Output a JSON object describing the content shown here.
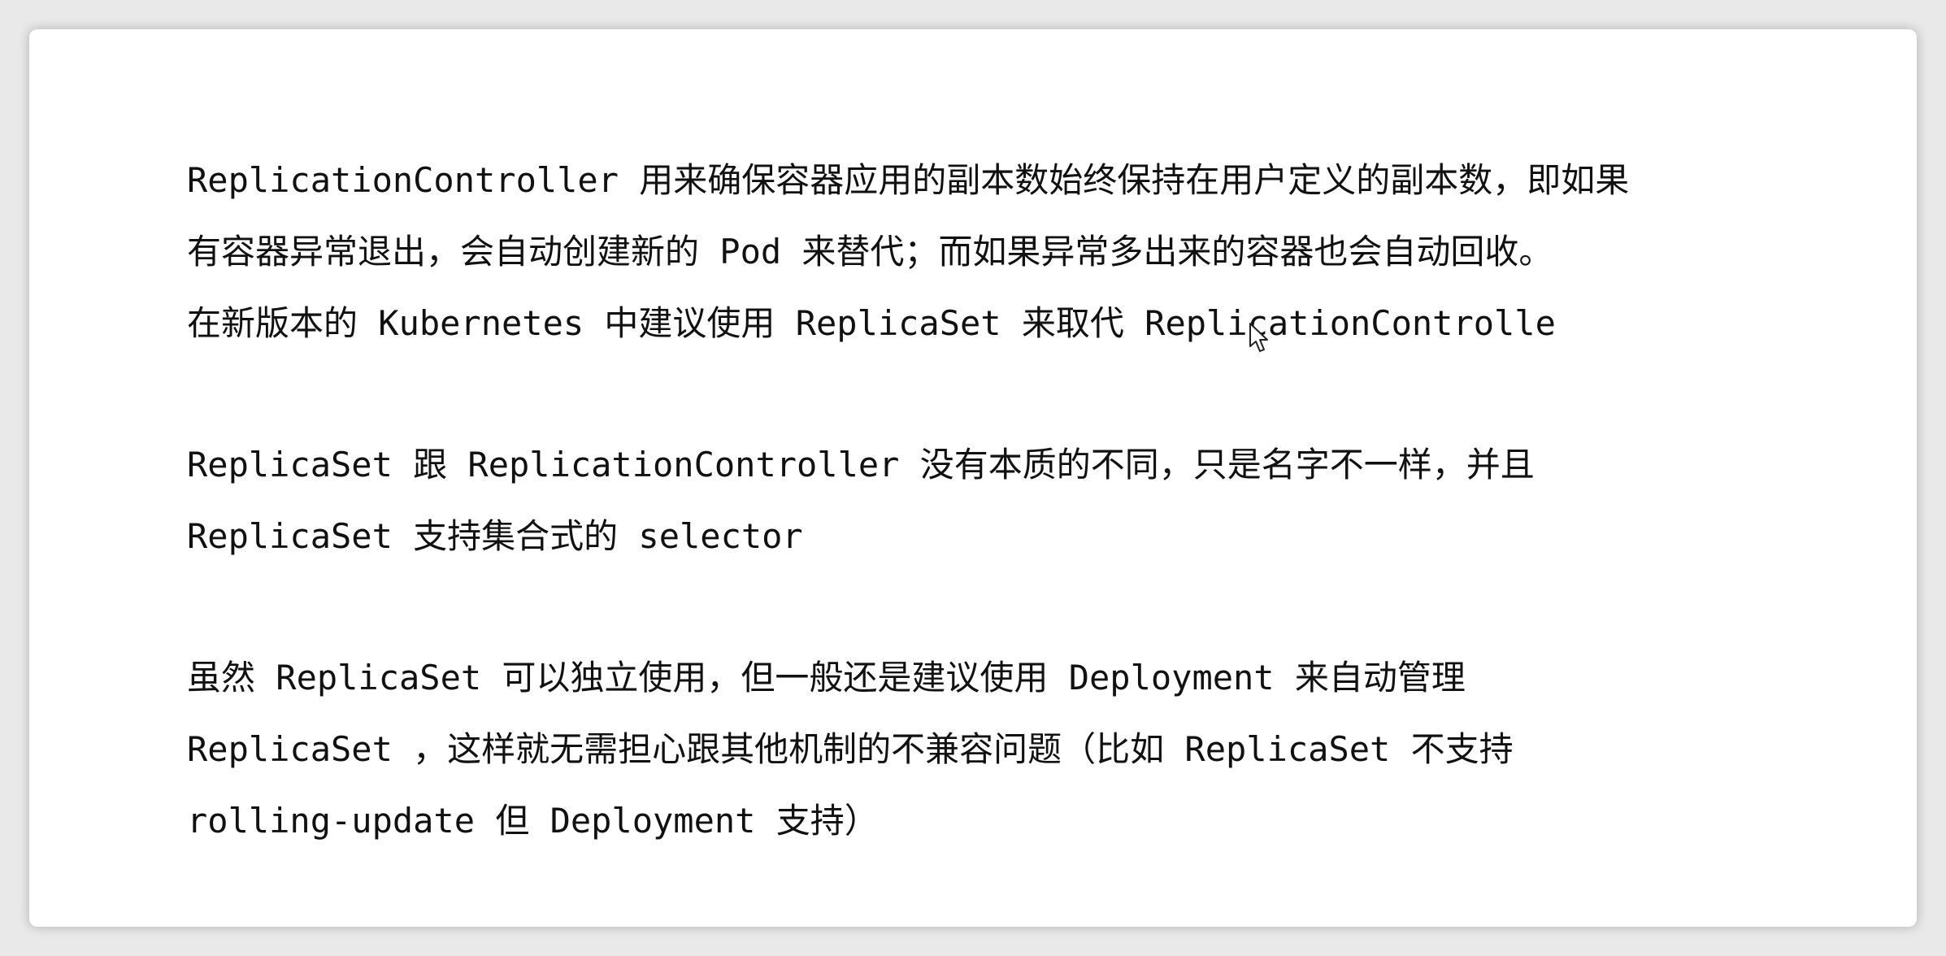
{
  "paragraphs": [
    {
      "lines": [
        "ReplicationController 用来确保容器应用的副本数始终保持在用户定义的副本数，即如果",
        "有容器异常退出，会自动创建新的 Pod 来替代；而如果异常多出来的容器也会自动回收。",
        "在新版本的 Kubernetes 中建议使用 ReplicaSet 来取代 ReplicationControlle"
      ]
    },
    {
      "lines": [
        "ReplicaSet 跟 ReplicationController 没有本质的不同，只是名字不一样，并且",
        "ReplicaSet 支持集合式的 selector"
      ]
    },
    {
      "lines": [
        "虽然 ReplicaSet 可以独立使用，但一般还是建议使用 Deployment 来自动管理",
        "ReplicaSet ，这样就无需担心跟其他机制的不兼容问题（比如 ReplicaSet 不支持",
        "rolling-update 但 Deployment 支持）"
      ]
    }
  ],
  "icons": {
    "cursor": "mouse-pointer-icon"
  },
  "colors": {
    "background": "#e9e9e9",
    "card": "#ffffff",
    "text": "#111111"
  }
}
